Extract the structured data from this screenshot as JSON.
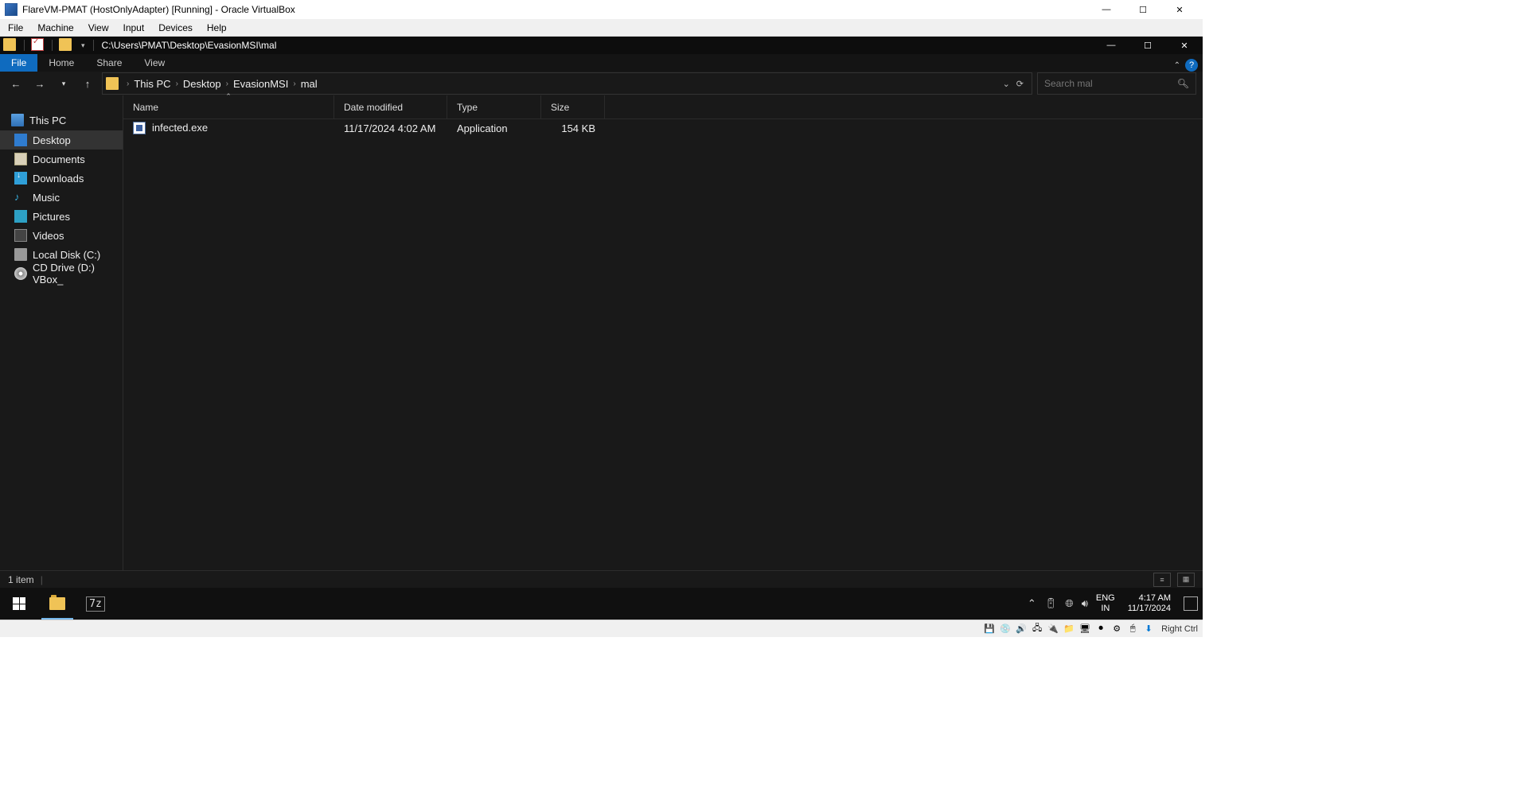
{
  "vb": {
    "title": "FlareVM-PMAT (HostOnlyAdapter) [Running] - Oracle VirtualBox",
    "menus": [
      "File",
      "Machine",
      "View",
      "Input",
      "Devices",
      "Help"
    ],
    "status_right": "Right Ctrl"
  },
  "explorer": {
    "title_path": "C:\\Users\\PMAT\\Desktop\\EvasionMSI\\mal",
    "ribbon": {
      "file": "File",
      "tabs": [
        "Home",
        "Share",
        "View"
      ]
    },
    "breadcrumb": [
      "This PC",
      "Desktop",
      "EvasionMSI",
      "mal"
    ],
    "search_placeholder": "Search mal",
    "sidebar": {
      "root": "This PC",
      "items": [
        "Desktop",
        "Documents",
        "Downloads",
        "Music",
        "Pictures",
        "Videos",
        "Local Disk (C:)",
        "CD Drive (D:) VBox_"
      ]
    },
    "columns": {
      "name": "Name",
      "date": "Date modified",
      "type": "Type",
      "size": "Size"
    },
    "files": [
      {
        "name": "infected.exe",
        "date": "11/17/2024 4:02 AM",
        "type": "Application",
        "size": "154 KB"
      }
    ],
    "status": "1 item"
  },
  "taskbar": {
    "lang1": "ENG",
    "lang2": "IN",
    "time": "4:17 AM",
    "date": "11/17/2024"
  },
  "col_widths": {
    "name": 250,
    "date": 142,
    "type": 118,
    "size": 80
  }
}
